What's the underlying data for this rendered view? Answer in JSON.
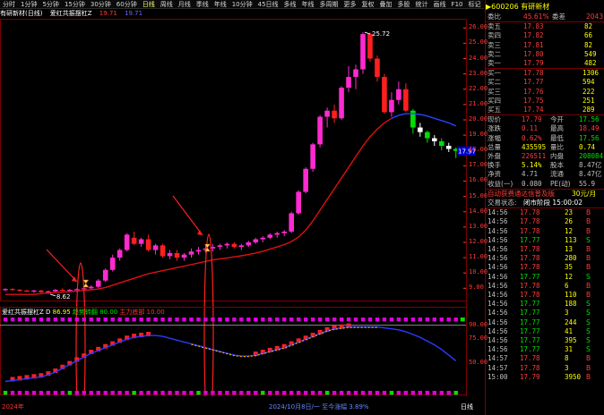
{
  "toolbar": {
    "items": [
      "分时",
      "1分钟",
      "5分钟",
      "15分钟",
      "30分钟",
      "60分钟",
      "日线",
      "周线",
      "月线",
      "季线",
      "年线",
      "10分钟",
      "45日线",
      "多线",
      "年线",
      "多周期",
      "更多"
    ],
    "selected_index": 6,
    "right_items": [
      "复权",
      "叠加",
      "多股",
      "统计",
      "画线",
      "F10",
      "标记",
      "-",
      "自选",
      "返回"
    ]
  },
  "chart_header": {
    "stock": "有研新材(日线)",
    "indicator_name": "爱红共振摆杠Z",
    "val1": "19.71",
    "val2": "19.71"
  },
  "price_axis": [
    {
      "label": "26.00",
      "value": 26.0
    },
    {
      "label": "25.00",
      "value": 25.0
    },
    {
      "label": "24.00",
      "value": 24.0
    },
    {
      "label": "23.00",
      "value": 23.0
    },
    {
      "label": "22.00",
      "value": 22.0
    },
    {
      "label": "21.00",
      "value": 21.0
    },
    {
      "label": "20.00",
      "value": 20.0
    },
    {
      "label": "19.00",
      "value": 19.0
    },
    {
      "label": "18.00",
      "value": 18.0
    },
    {
      "label": "17.00",
      "value": 17.0
    },
    {
      "label": "16.00",
      "value": 16.0
    },
    {
      "label": "15.00",
      "value": 15.0
    },
    {
      "label": "14.00",
      "value": 14.0
    },
    {
      "label": "13.00",
      "value": 13.0
    },
    {
      "label": "12.00",
      "value": 12.0
    },
    {
      "label": "11.00",
      "value": 11.0
    },
    {
      "label": "10.00",
      "value": 10.0
    },
    {
      "label": "9.00",
      "value": 9.0
    }
  ],
  "price_annotations": {
    "high": "25.72",
    "low": "8.62",
    "current": "17.97"
  },
  "chart_data": {
    "type": "candlestick",
    "series": [
      {
        "name": "candles",
        "ohlc": [
          [
            8.9,
            9.0,
            8.8,
            8.95
          ],
          [
            8.95,
            9.0,
            8.85,
            8.9
          ],
          [
            8.9,
            8.95,
            8.8,
            8.85
          ],
          [
            8.85,
            8.9,
            8.75,
            8.8
          ],
          [
            8.8,
            8.9,
            8.7,
            8.85
          ],
          [
            8.85,
            8.9,
            8.7,
            8.75
          ],
          [
            8.75,
            8.85,
            8.62,
            8.8
          ],
          [
            8.8,
            8.95,
            8.7,
            8.9
          ],
          [
            8.9,
            9.0,
            8.8,
            8.85
          ],
          [
            8.85,
            8.95,
            8.75,
            8.9
          ],
          [
            8.9,
            9.0,
            8.8,
            8.95
          ],
          [
            8.95,
            9.1,
            8.85,
            9.0
          ],
          [
            9.0,
            9.2,
            8.9,
            9.1
          ],
          [
            9.1,
            9.6,
            9.0,
            9.5
          ],
          [
            9.5,
            10.3,
            9.4,
            10.2
          ],
          [
            10.2,
            11.2,
            10.1,
            11.0
          ],
          [
            11.0,
            11.6,
            10.8,
            11.5
          ],
          [
            11.5,
            12.6,
            11.4,
            12.5
          ],
          [
            12.3,
            12.7,
            11.8,
            11.9
          ],
          [
            11.9,
            12.3,
            11.7,
            12.2
          ],
          [
            12.2,
            12.5,
            11.4,
            11.5
          ],
          [
            11.5,
            11.9,
            11.2,
            11.8
          ],
          [
            11.8,
            11.9,
            11.0,
            11.1
          ],
          [
            11.1,
            11.5,
            10.9,
            11.3
          ],
          [
            11.3,
            11.5,
            10.8,
            11.0
          ],
          [
            11.0,
            11.3,
            10.8,
            11.2
          ],
          [
            11.2,
            11.6,
            11.0,
            11.4
          ],
          [
            11.4,
            11.7,
            11.2,
            11.5
          ],
          [
            11.5,
            11.8,
            11.3,
            11.6
          ],
          [
            11.6,
            11.9,
            11.4,
            11.7
          ],
          [
            11.7,
            11.9,
            11.5,
            11.8
          ],
          [
            11.8,
            12.0,
            11.6,
            11.9
          ],
          [
            11.9,
            12.0,
            11.6,
            11.7
          ],
          [
            11.7,
            11.9,
            11.5,
            11.8
          ],
          [
            11.8,
            12.1,
            11.7,
            12.0
          ],
          [
            12.0,
            12.3,
            11.9,
            12.2
          ],
          [
            12.2,
            12.4,
            12.0,
            12.3
          ],
          [
            12.3,
            12.6,
            12.2,
            12.5
          ],
          [
            12.5,
            12.7,
            12.3,
            12.6
          ],
          [
            12.6,
            12.8,
            12.4,
            12.7
          ],
          [
            12.7,
            14.0,
            12.6,
            13.9
          ],
          [
            13.9,
            15.4,
            13.8,
            15.3
          ],
          [
            15.3,
            16.9,
            15.2,
            16.8
          ],
          [
            16.8,
            18.5,
            16.6,
            18.4
          ],
          [
            18.4,
            20.3,
            18.2,
            20.2
          ],
          [
            20.2,
            20.8,
            19.5,
            20.6
          ],
          [
            20.6,
            21.0,
            19.8,
            20.1
          ],
          [
            20.1,
            22.2,
            20.0,
            22.1
          ],
          [
            22.1,
            23.5,
            21.8,
            22.8
          ],
          [
            22.8,
            23.6,
            22.0,
            23.3
          ],
          [
            23.3,
            25.72,
            23.0,
            25.6
          ],
          [
            25.6,
            25.7,
            23.8,
            24.0
          ],
          [
            24.0,
            24.2,
            22.5,
            22.8
          ],
          [
            22.8,
            23.0,
            20.4,
            20.5
          ],
          [
            20.5,
            21.8,
            20.2,
            21.3
          ],
          [
            21.3,
            22.5,
            21.0,
            22.0
          ],
          [
            22.0,
            22.4,
            20.5,
            20.6
          ],
          [
            20.6,
            20.7,
            19.1,
            19.5
          ],
          [
            19.5,
            19.8,
            18.9,
            19.2
          ],
          [
            19.2,
            19.3,
            18.5,
            18.8
          ],
          [
            18.8,
            19.0,
            18.3,
            18.6
          ],
          [
            18.6,
            18.8,
            18.0,
            18.3
          ],
          [
            18.3,
            18.5,
            17.9,
            18.1
          ],
          [
            18.1,
            18.2,
            17.5,
            17.97
          ]
        ]
      },
      {
        "name": "ma",
        "values": [
          8.6,
          8.6,
          8.6,
          8.6,
          8.6,
          8.65,
          8.7,
          8.72,
          8.75,
          8.78,
          8.82,
          8.86,
          8.9,
          8.95,
          9.05,
          9.2,
          9.35,
          9.5,
          9.65,
          9.8,
          9.95,
          10.05,
          10.15,
          10.25,
          10.35,
          10.45,
          10.55,
          10.65,
          10.75,
          10.85,
          10.92,
          10.98,
          11.05,
          11.12,
          11.2,
          11.3,
          11.42,
          11.55,
          11.7,
          11.85,
          12.05,
          12.35,
          12.8,
          13.4,
          14.1,
          14.8,
          15.5,
          16.2,
          16.9,
          17.6,
          18.3,
          18.9,
          19.4,
          19.8,
          20.1,
          20.3,
          20.4,
          20.4,
          20.35,
          20.25,
          20.1,
          19.95,
          19.8,
          19.6
        ]
      }
    ]
  },
  "lower_header": {
    "name": "爱红共振摆杠Z",
    "label": "D",
    "v1": "86.95",
    "v2_label": "趋势转翻",
    "v2": "80.00",
    "v3_label": "主力底部",
    "v3": "10.00"
  },
  "lower_axis": [
    {
      "label": "90.00",
      "value": 90
    },
    {
      "label": "75.00",
      "value": 75
    },
    {
      "label": "50.00",
      "value": 50
    }
  ],
  "lower_data": {
    "trend": [
      30,
      31,
      32,
      33,
      34,
      35,
      37,
      40,
      44,
      48,
      52,
      56,
      60,
      63,
      66,
      69,
      72,
      75,
      77,
      78,
      79,
      79,
      78,
      76,
      74,
      72,
      70,
      68,
      66,
      64,
      62,
      60,
      58,
      57,
      57,
      58,
      60,
      62,
      64,
      66,
      69,
      72,
      75,
      78,
      81,
      84,
      86,
      87,
      88,
      88,
      88,
      88,
      88,
      87,
      86,
      85,
      83,
      80,
      77,
      73,
      69,
      64,
      58,
      52
    ]
  },
  "footer": {
    "left_label": "2024年",
    "mid_label": "2024/10月8日/一 至今涨幅 3.89%",
    "right_label": "日线"
  },
  "quote": {
    "code": "600206",
    "name": "有研新材",
    "webi_label": "委比",
    "webi_val": "45.61%",
    "wecha_label": "委差",
    "wecha_val": "2043",
    "asks": [
      {
        "label": "卖五",
        "price": "17.83",
        "vol": "82"
      },
      {
        "label": "卖四",
        "price": "17.82",
        "vol": "66"
      },
      {
        "label": "卖三",
        "price": "17.81",
        "vol": "82"
      },
      {
        "label": "卖二",
        "price": "17.80",
        "vol": "549"
      },
      {
        "label": "卖一",
        "price": "17.79",
        "vol": "482"
      }
    ],
    "bids": [
      {
        "label": "买一",
        "price": "17.78",
        "vol": "1306"
      },
      {
        "label": "买二",
        "price": "17.77",
        "vol": "594"
      },
      {
        "label": "买三",
        "price": "17.76",
        "vol": "222"
      },
      {
        "label": "买四",
        "price": "17.75",
        "vol": "251"
      },
      {
        "label": "买五",
        "price": "17.74",
        "vol": "289"
      }
    ],
    "stats": [
      {
        "l1": "现价",
        "v1": "17.79",
        "l2": "今开",
        "v2": "17.56",
        "c1": "red",
        "c2": "green"
      },
      {
        "l1": "涨跌",
        "v1": "0.11",
        "l2": "最高",
        "v2": "18.49",
        "c1": "red",
        "c2": "red"
      },
      {
        "l1": "涨幅",
        "v1": "0.62%",
        "l2": "最低",
        "v2": "17.56",
        "c1": "red",
        "c2": "green"
      },
      {
        "l1": "总量",
        "v1": "435595",
        "l2": "量比",
        "v2": "0.74",
        "c1": "yellow",
        "c2": "yellow"
      },
      {
        "l1": "外盘",
        "v1": "226511",
        "l2": "内盘",
        "v2": "208084",
        "c1": "red",
        "c2": "green"
      },
      {
        "l1": "换手",
        "v1": "5.14%",
        "l2": "股本",
        "v2": "8.47亿",
        "c1": "yellow",
        "c2": "gray"
      },
      {
        "l1": "净资",
        "v1": "4.71",
        "l2": "流通",
        "v2": "8.47亿",
        "c1": "gray",
        "c2": "gray"
      },
      {
        "l1": "收益(一)",
        "v1": "0.080",
        "l2": "PE(动)",
        "v2": "55.9",
        "c1": "gray",
        "c2": "gray"
      }
    ],
    "industry": "自动获费通达信普及版",
    "industry_val": "30元/月",
    "status_label": "交易状态:",
    "status_val": "闭市阶段 15:00:02",
    "ticks": [
      {
        "time": "14:56",
        "price": "17.78",
        "vol": "23",
        "bs": "B"
      },
      {
        "time": "14:56",
        "price": "17.78",
        "vol": "26",
        "bs": "B"
      },
      {
        "time": "14:56",
        "price": "17.78",
        "vol": "12",
        "bs": "B"
      },
      {
        "time": "14:56",
        "price": "17.77",
        "vol": "113",
        "bs": "S"
      },
      {
        "time": "14:56",
        "price": "17.78",
        "vol": "13",
        "bs": "B"
      },
      {
        "time": "14:56",
        "price": "17.78",
        "vol": "280",
        "bs": "B"
      },
      {
        "time": "14:56",
        "price": "17.78",
        "vol": "35",
        "bs": "B"
      },
      {
        "time": "14:56",
        "price": "17.77",
        "vol": "12",
        "bs": "S"
      },
      {
        "time": "14:56",
        "price": "17.78",
        "vol": "6",
        "bs": "B"
      },
      {
        "time": "14:56",
        "price": "17.78",
        "vol": "110",
        "bs": "B"
      },
      {
        "time": "14:56",
        "price": "17.77",
        "vol": "188",
        "bs": "S"
      },
      {
        "time": "14:56",
        "price": "17.77",
        "vol": "3",
        "bs": "S"
      },
      {
        "time": "14:56",
        "price": "17.77",
        "vol": "244",
        "bs": "S"
      },
      {
        "time": "14:56",
        "price": "17.77",
        "vol": "41",
        "bs": "S"
      },
      {
        "time": "14:56",
        "price": "17.77",
        "vol": "395",
        "bs": "S"
      },
      {
        "time": "14:56",
        "price": "17.77",
        "vol": "31",
        "bs": "S"
      },
      {
        "time": "14:57",
        "price": "17.78",
        "vol": "8",
        "bs": "B"
      },
      {
        "time": "14:57",
        "price": "17.78",
        "vol": "3",
        "bs": "B"
      },
      {
        "time": "15:00",
        "price": "17.79",
        "vol": "3950",
        "bs": "B"
      }
    ]
  },
  "colors": {
    "up": "#ff2bd0",
    "down": "#ff1f1f",
    "down_small": "#00e000",
    "ma": "#e01010",
    "ma_tail": "#2244ff",
    "bg": "#000000",
    "grid": "#7a0000",
    "marker_bar": "#e000e0"
  }
}
